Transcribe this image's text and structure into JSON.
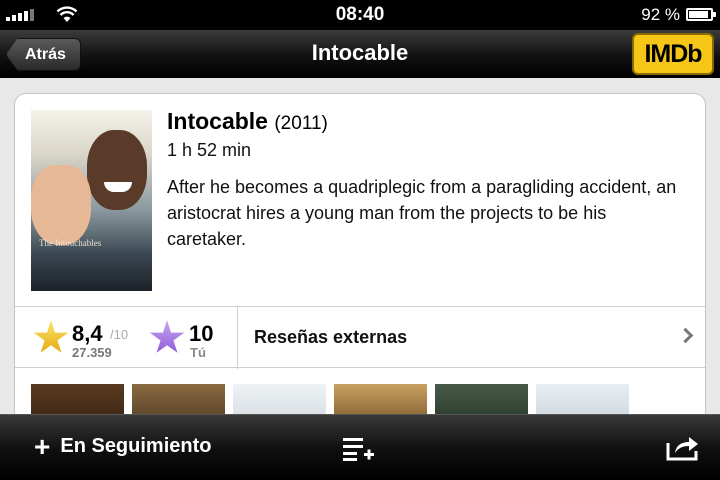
{
  "status_bar": {
    "time": "08:40",
    "battery_pct_label": "92 %",
    "battery_level": 0.92
  },
  "nav": {
    "back_label": "Atrás",
    "title": "Intocable",
    "logo_text": "IMDb"
  },
  "movie": {
    "title": "Intocable",
    "year": "(2011)",
    "runtime": "1 h 52 min",
    "plot": "After he becomes a quadriplegic from a paragliding accident, an aristocrat hires a young man from the projects to be his caretaker.",
    "poster_title": "The Intouchables"
  },
  "rating": {
    "value": "8,4",
    "max": "/10",
    "count": "27.359",
    "user_value": "10",
    "user_label": "Tú"
  },
  "external_reviews": {
    "label": "Reseñas externas"
  },
  "toolbar": {
    "follow_label": "En Seguimiento",
    "icons": [
      "plus-icon",
      "add-to-list-icon",
      "share-icon"
    ]
  },
  "colors": {
    "imdb_yellow": "#f5c518",
    "star_gold": "#f0c020",
    "star_purple": "#a77ee6"
  }
}
